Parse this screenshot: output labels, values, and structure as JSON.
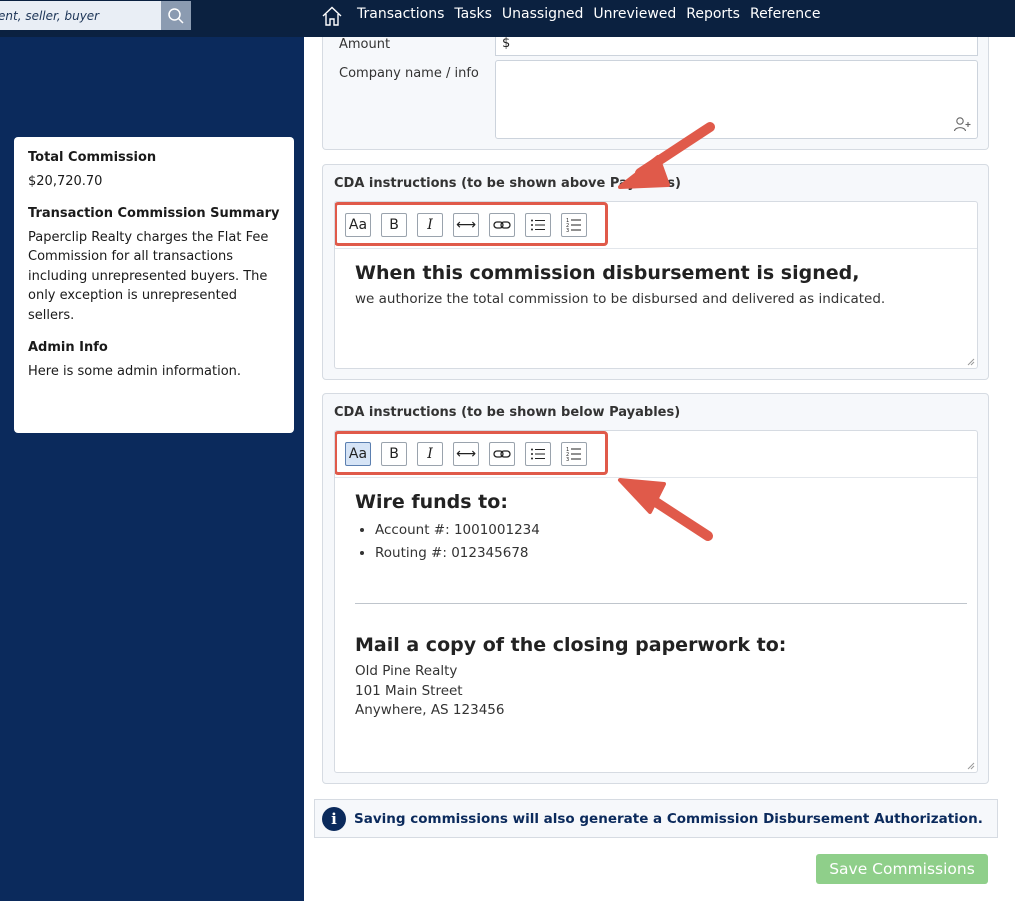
{
  "header": {
    "search_placeholder": "ent, seller, buyer",
    "nav": [
      "Transactions",
      "Tasks",
      "Unassigned",
      "Unreviewed",
      "Reports",
      "Reference"
    ]
  },
  "sidebar": {
    "total_commission_label": "Total Commission",
    "total_commission_value": "$20,720.70",
    "summary_title": "Transaction Commission Summary",
    "summary_text": "Paperclip Realty charges the Flat Fee Commission for all transactions including unrepresented buyers. The only exception is unrepresented sellers.",
    "admin_title": "Admin Info",
    "admin_text": "Here is some admin information."
  },
  "form": {
    "amount_label": "Amount",
    "amount_value": "$",
    "company_label": "Company name / info"
  },
  "cda_above": {
    "title": "CDA instructions (to be shown above Payables)",
    "heading": "When this commission disbursement is signed,",
    "text": "we authorize the total commission to be disbursed and delivered as indicated."
  },
  "cda_below": {
    "title": "CDA instructions (to be shown below Payables)",
    "wire_heading": "Wire funds to:",
    "wire_items": [
      "Account #: 1001001234",
      "Routing #: 012345678"
    ],
    "mail_heading": "Mail a copy of the closing paperwork to:",
    "address_lines": [
      "Old Pine Realty",
      "101 Main Street",
      "Anywhere, AS 123456"
    ]
  },
  "toolbar": {
    "font_label": "Aa",
    "bold_label": "B",
    "italic_label": "I",
    "width_label": "⟷",
    "icons": [
      "font-size-icon",
      "bold-icon",
      "italic-icon",
      "horizontal-rule-icon",
      "link-icon",
      "bullet-list-icon",
      "numbered-list-icon"
    ]
  },
  "info_banner": {
    "icon_label": "i",
    "text": "Saving commissions will also generate a Commission Disbursement Authorization."
  },
  "save_button": "Save Commissions",
  "colors": {
    "header_bg": "#0b2140",
    "sidebar_bg": "#0b2a5c",
    "highlight": "#e05a4a",
    "save_button": "#8fcf8a"
  }
}
